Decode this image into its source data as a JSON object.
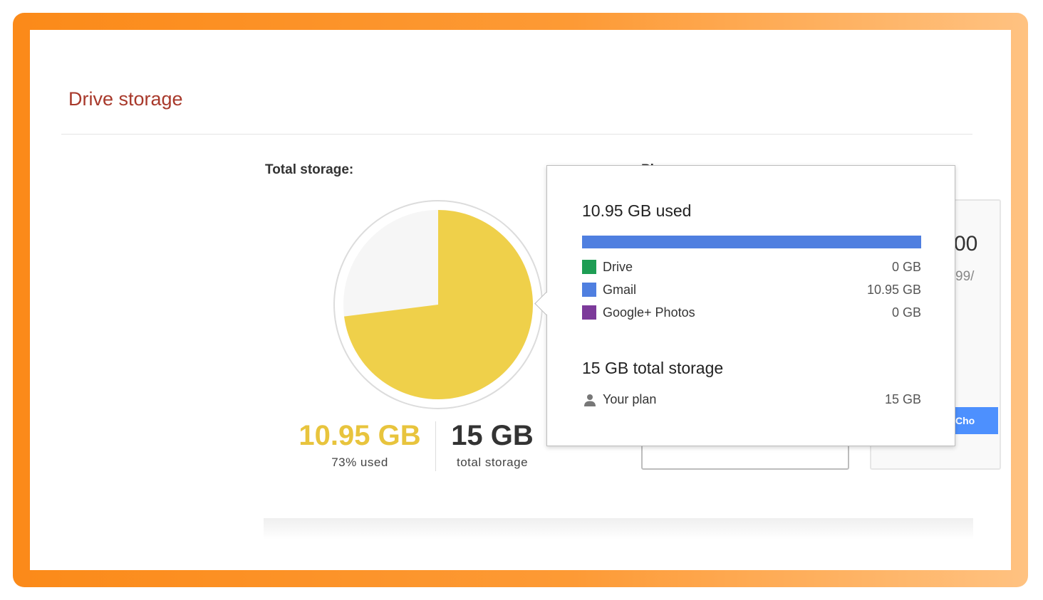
{
  "page": {
    "title": "Drive storage"
  },
  "total_storage": {
    "label": "Total storage:",
    "used_amount": "10.95 GB",
    "used_caption": "73% used",
    "used_fraction": 0.73,
    "total_amount": "15 GB",
    "total_caption": "total storage",
    "colors": {
      "used": "#efd04a",
      "free": "#f6f6f6",
      "used_text": "#e8c43d"
    }
  },
  "plans": {
    "label": "Pl",
    "partial_price": "00",
    "partial_sub": "99/",
    "partial_button": "Cho"
  },
  "popup": {
    "used_title": "10.95 GB used",
    "bar_fraction": 1.0,
    "bar_color": "#4f7fe0",
    "breakdown": [
      {
        "label": "Drive",
        "value": "0 GB",
        "color": "#1e9d54"
      },
      {
        "label": "Gmail",
        "value": "10.95 GB",
        "color": "#4f7fe0"
      },
      {
        "label": "Google+ Photos",
        "value": "0 GB",
        "color": "#7c3a9a"
      }
    ],
    "total_title": "15 GB total storage",
    "plan_label": "Your plan",
    "plan_value": "15 GB",
    "plan_icon": "person-icon"
  }
}
